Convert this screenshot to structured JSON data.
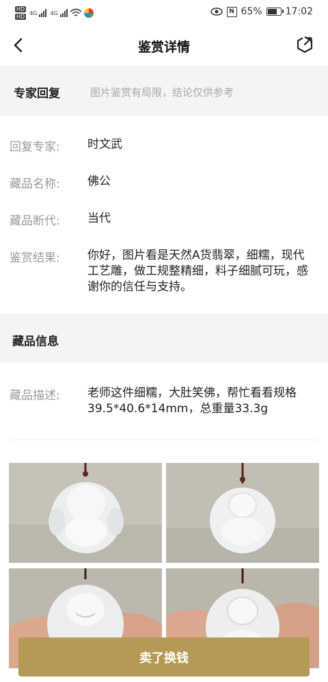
{
  "status_bar": {
    "hd1": "HD",
    "hd2": "HD",
    "net1": "4G",
    "net2": "4G",
    "battery_percent": "65%",
    "battery_level": 0.65,
    "time": "17:02",
    "icons": [
      "hd-icon",
      "signal-icon",
      "wifi-icon",
      "app-icon",
      "eye-icon",
      "nfc-icon",
      "battery-icon"
    ]
  },
  "header": {
    "title": "鉴赏详情",
    "back_icon": "chevron-left-icon",
    "share_icon": "share-icon"
  },
  "expert_reply": {
    "title": "专家回复",
    "disclaimer": "图片鉴赏有局限，结论仅供参考"
  },
  "details": [
    {
      "label": "回复专家:",
      "value": "时文武"
    },
    {
      "label": "藏品名称:",
      "value": "佛公"
    },
    {
      "label": "藏品断代:",
      "value": "当代"
    },
    {
      "label": "鉴赏结果:",
      "value": "你好，图片看是天然A货翡翠，细糯，现代工艺雕，做工规整精细，料子细腻可玩，感谢你的信任与支持。"
    }
  ],
  "collection_info": {
    "title": "藏品信息",
    "desc_label": "藏品描述:",
    "desc_value": "老师这件细糯，大肚笑佛，帮忙看看规格39.5*40.6*14mm，总重量33.3g"
  },
  "photos": [
    "jade-buddha-photo-front",
    "jade-buddha-photo-back",
    "jade-buddha-photo-hand-front",
    "jade-buddha-photo-hand-back"
  ],
  "colors": {
    "accent": "#b59a55",
    "section_bg": "#f4f4f4",
    "label": "#9a9a9a"
  },
  "bottom": {
    "sell_label": "卖了换钱"
  }
}
